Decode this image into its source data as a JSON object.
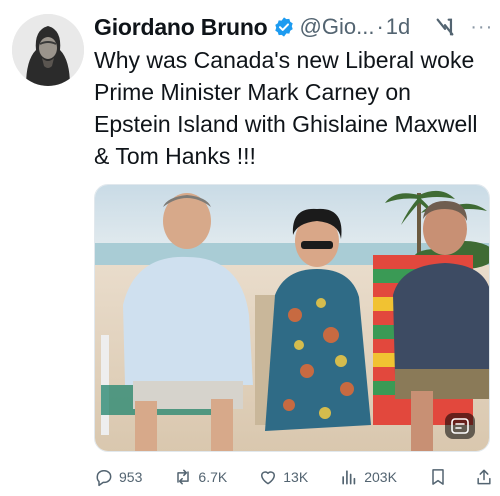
{
  "author": {
    "name": "Giordano Bruno",
    "handle": "@Gio...",
    "separator": "·",
    "time": "1d",
    "more": "···"
  },
  "tweet": {
    "text": "Why was Canada's new Liberal woke Prime Minister Mark Carney on Epstein Island with Ghislaine Maxwell & Tom Hanks !!!"
  },
  "actions": {
    "replies": "953",
    "reposts": "6.7K",
    "likes": "13K",
    "views": "203K"
  },
  "icons": {
    "verified": "verified-badge-icon",
    "grok": "grok-icon",
    "more": "more-icon",
    "reply": "reply-icon",
    "repost": "repost-icon",
    "like": "heart-icon",
    "views": "views-icon",
    "bookmark": "bookmark-icon",
    "share": "share-icon",
    "alt": "text-badge-icon"
  },
  "colors": {
    "verified": "#1d9bf0",
    "secondary_text": "#536471",
    "primary_text": "#0f1419"
  }
}
